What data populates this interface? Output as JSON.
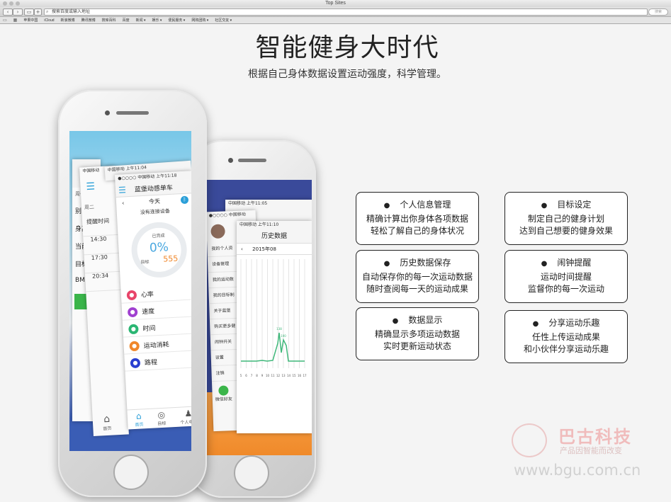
{
  "browser": {
    "title": "Top Sites",
    "url_placeholder": "搜索百度或输入地址",
    "search_placeholder": "搜索",
    "bookmarks": [
      "苹果中国",
      "iCloud",
      "新浪微博",
      "腾讯微博",
      "搜库百科",
      "百度",
      "新闻 ▾",
      "娱乐 ▾",
      "便民服务 ▾",
      "网购团购 ▾",
      "社区交友 ▾"
    ]
  },
  "hero": {
    "title": "智能健身大时代",
    "subtitle": "根据自己身体数据设置运动强度，科学管理。"
  },
  "phone_left": {
    "back_card": {
      "time": "上午11:09",
      "carrier": "中国移动",
      "days": [
        "周一",
        "周二"
      ],
      "reminder": "提醒时间",
      "times": [
        "14:30",
        "17:30",
        "20:34"
      ],
      "labels": [
        "别",
        "身高",
        "当前体",
        "目标体",
        "BMI"
      ],
      "nav": "首页"
    },
    "mid_card": {
      "time": "上午11:04",
      "carrier": "中国移动"
    },
    "front_card": {
      "time": "上午11:18",
      "carrier": "●○○○○ 中国移动",
      "title": "蓝堡动感单车",
      "today": "今天",
      "no_device": "没有连接设备",
      "completed": "已完成",
      "percent": "0%",
      "goal_label": "目标",
      "goal_value": "555",
      "features": [
        {
          "label": "心率",
          "color": "#e8456a",
          "icon": "heart-icon"
        },
        {
          "label": "速度",
          "color": "#a040d0",
          "icon": "speed-icon"
        },
        {
          "label": "时间",
          "color": "#2bb673",
          "icon": "clock-icon"
        },
        {
          "label": "运动消耗",
          "color": "#f0872a",
          "icon": "flame-icon"
        },
        {
          "label": "路程",
          "color": "#2a3fd0",
          "icon": "route-icon"
        }
      ],
      "tabs": [
        "首页",
        "目标",
        "个人中心"
      ]
    }
  },
  "phone_right": {
    "back_card": {
      "time": "上午11:05",
      "carrier": "中国移动"
    },
    "menu_card": {
      "time": "上午11:10",
      "carrier": "●○○○○ 中国移动",
      "items": [
        "我的个人资",
        "设备管理",
        "我的运动数",
        "我的目标制",
        "关于蓝堡",
        "购买更多健",
        "闹钟开关",
        "设置",
        "注销"
      ],
      "share": [
        "微信好友",
        "QQ"
      ]
    },
    "front_card": {
      "time": "下午",
      "title": "历史数据",
      "date": "2015年08",
      "chart_xlabels": [
        "5",
        "6",
        "7",
        "8",
        "9",
        "10",
        "11",
        "12",
        "13",
        "14",
        "15",
        "16",
        "17"
      ],
      "peak_labels": [
        "138",
        "100"
      ]
    }
  },
  "features": [
    {
      "title": "个人信息管理",
      "lines": [
        "精确计算出你身体各项数据",
        "轻松了解自己的身体状况"
      ]
    },
    {
      "title": "目标设定",
      "lines": [
        "制定自己的健身计划",
        "达到自己想要的健身效果"
      ]
    },
    {
      "title": "历史数据保存",
      "lines": [
        "自动保存你的每一次运动数据",
        "随时查阅每一天的运动成果"
      ]
    },
    {
      "title": "闹钟提醒",
      "lines": [
        "运动时间提醒",
        "监督你的每一次运动"
      ]
    },
    {
      "title": "数据显示",
      "lines": [
        "精确显示多项运动数据",
        "实时更新运动状态"
      ]
    },
    {
      "title": "分享运动乐趣",
      "lines": [
        "任性上传运动成果",
        "和小伙伴分享运动乐趣"
      ]
    }
  ],
  "watermark": {
    "brand": "巴古科技",
    "slogan": "产品因智能而改变",
    "url": "www.bgu.com.cn"
  }
}
